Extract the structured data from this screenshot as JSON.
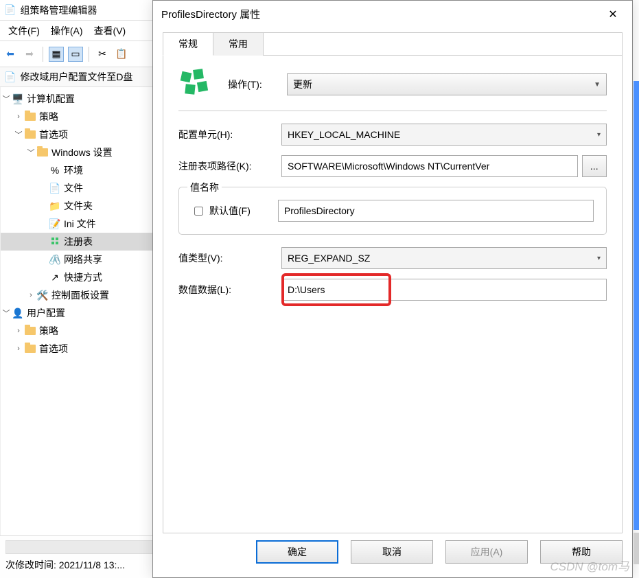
{
  "main_window": {
    "title": "组策略管理编辑器",
    "menu": {
      "file": "文件(F)",
      "action": "操作(A)",
      "view": "查看(V)"
    },
    "tree_header": "修改域用户配置文件至D盘",
    "tree": {
      "computer_config": "计算机配置",
      "policies": "策略",
      "preferences": "首选项",
      "windows_settings": "Windows 设置",
      "environment": "环境",
      "files": "文件",
      "folders": "文件夹",
      "ini_files": "Ini 文件",
      "registry": "注册表",
      "network_shares": "网络共享",
      "shortcuts": "快捷方式",
      "control_panel": "控制面板设置",
      "user_config": "用户配置",
      "user_policies": "策略",
      "user_preferences": "首选项"
    },
    "status": "次修改时间: 2021/11/8 13:..."
  },
  "dialog": {
    "title": "ProfilesDirectory 属性",
    "tabs": {
      "general": "常规",
      "common": "常用"
    },
    "action_label": "操作(T):",
    "action_value": "更新",
    "hive_label": "配置单元(H):",
    "hive_value": "HKEY_LOCAL_MACHINE",
    "keypath_label": "注册表项路径(K):",
    "keypath_value": "SOFTWARE\\Microsoft\\Windows NT\\CurrentVer",
    "browse_label": "...",
    "value_name_group": "值名称",
    "default_checkbox": "默认值(F)",
    "value_name": "ProfilesDirectory",
    "value_type_label": "值类型(V):",
    "value_type": "REG_EXPAND_SZ",
    "value_data_label": "数值数据(L):",
    "value_data": "D:\\Users",
    "buttons": {
      "ok": "确定",
      "cancel": "取消",
      "apply": "应用(A)",
      "help": "帮助"
    }
  },
  "watermark": "CSDN @tom马"
}
